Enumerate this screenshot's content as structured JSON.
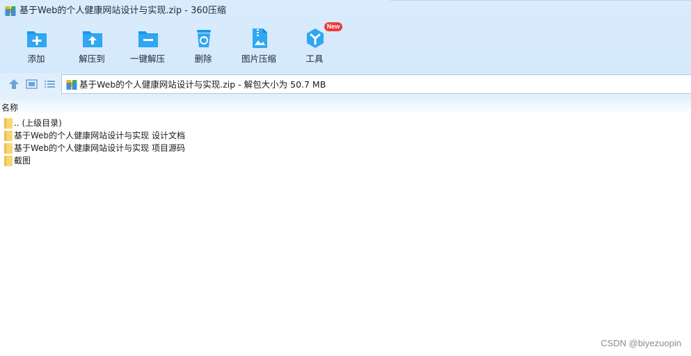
{
  "window": {
    "title": "基于Web的个人健康网站设计与实现.zip - 360压缩"
  },
  "toolbar": {
    "add": "添加",
    "extract_to": "解压到",
    "one_click_extract": "一键解压",
    "delete": "删除",
    "image_compress": "图片压缩",
    "tools": "工具",
    "tools_badge": "New"
  },
  "addressbar": {
    "path": "基于Web的个人健康网站设计与实现.zip - 解包大小为 50.7 MB"
  },
  "list": {
    "column_name": "名称",
    "items": [
      {
        "label": ".. (上级目录)"
      },
      {
        "label": "基于Web的个人健康网站设计与实现 设计文档"
      },
      {
        "label": "基于Web的个人健康网站设计与实现 项目源码"
      },
      {
        "label": "截图"
      }
    ]
  },
  "watermark": "CSDN @biyezuopin",
  "colors": {
    "accent": "#1e96eb",
    "folder": "#f7d674",
    "badge": "#ee3a3a"
  }
}
